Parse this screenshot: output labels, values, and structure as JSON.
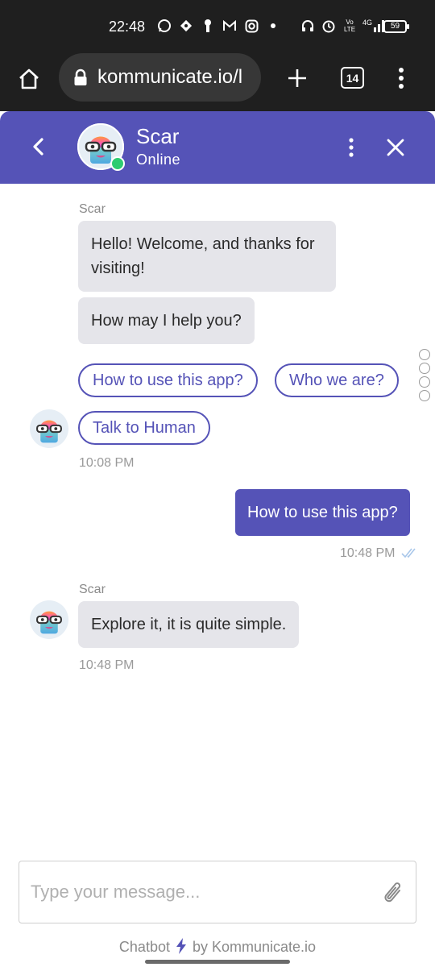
{
  "status_bar": {
    "time": "22:48",
    "network": "4G",
    "network_sub": "Vo LTE",
    "battery": "59",
    "icons_left": [
      "whatsapp-icon",
      "location-icon",
      "key-icon",
      "gmail-icon",
      "instagram-icon",
      "dot-icon"
    ],
    "icons_right": [
      "headphones-icon",
      "alarm-icon",
      "volte-icon",
      "signal-icon"
    ]
  },
  "browser": {
    "url": "kommunicate.io/l",
    "tab_count": "14"
  },
  "header": {
    "agent_name": "Scar",
    "agent_status": "Online",
    "accent_color": "#5553b7"
  },
  "conversation": {
    "group1": {
      "sender": "Scar",
      "messages": [
        "Hello! Welcome, and thanks for visiting!",
        "How may I help you?"
      ],
      "quick_replies": [
        "How to use this app?",
        "Who we are?",
        "Talk to Human"
      ],
      "time": "10:08 PM"
    },
    "outgoing": {
      "text": "How to use this app?",
      "time": "10:48 PM"
    },
    "group2": {
      "sender": "Scar",
      "message": "Explore it, it is quite simple.",
      "time": "10:48 PM"
    }
  },
  "composer": {
    "placeholder": "Type your message..."
  },
  "footer": {
    "prefix": "Chatbot",
    "suffix": "by Kommunicate.io"
  }
}
